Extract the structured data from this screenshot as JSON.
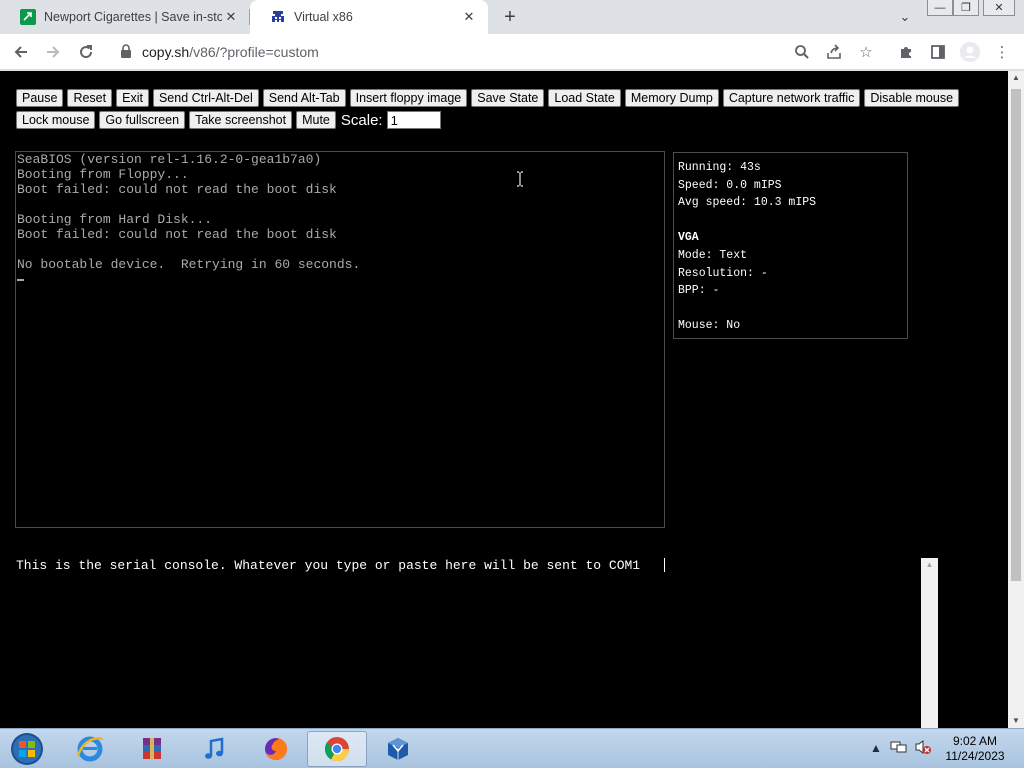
{
  "browser": {
    "tabs": [
      {
        "title": "Newport Cigarettes | Save in-sto",
        "active": false
      },
      {
        "title": "Virtual x86",
        "active": true
      }
    ],
    "address": {
      "host": "copy.sh",
      "path": "/v86/?profile=custom"
    }
  },
  "toolbar_buttons": {
    "row1": [
      "Pause",
      "Reset",
      "Exit",
      "Send Ctrl-Alt-Del",
      "Send Alt-Tab",
      "Insert floppy image",
      "Save State",
      "Load State",
      "Memory Dump",
      "Capture network traffic",
      "Disable mouse"
    ],
    "row2": [
      "Lock mouse",
      "Go fullscreen",
      "Take screenshot",
      "Mute"
    ],
    "scale_label": "Scale:",
    "scale_value": "1"
  },
  "screen": {
    "lines": [
      "SeaBIOS (version rel-1.16.2-0-gea1b7a0)",
      "Booting from Floppy...",
      "Boot failed: could not read the boot disk",
      "",
      "Booting from Hard Disk...",
      "Boot failed: could not read the boot disk",
      "",
      "No bootable device.  Retrying in 60 seconds."
    ]
  },
  "info": {
    "running": "Running: 43s",
    "speed": "Speed: 0.0 mIPS",
    "avg_speed": "Avg speed: 10.3 mIPS",
    "vga_heading": "VGA",
    "mode": "Mode: Text",
    "resolution": "Resolution: -",
    "bpp": "BPP: -",
    "mouse": "Mouse: No"
  },
  "serial": {
    "text": "This is the serial console. Whatever you type or paste here will be sent to COM1"
  },
  "taskbar": {
    "apps": [
      "internet-explorer",
      "winrar",
      "itunes",
      "firefox",
      "chrome",
      "virtualbox"
    ],
    "active_app": "chrome",
    "time": "9:02 AM",
    "date": "11/24/2023"
  }
}
